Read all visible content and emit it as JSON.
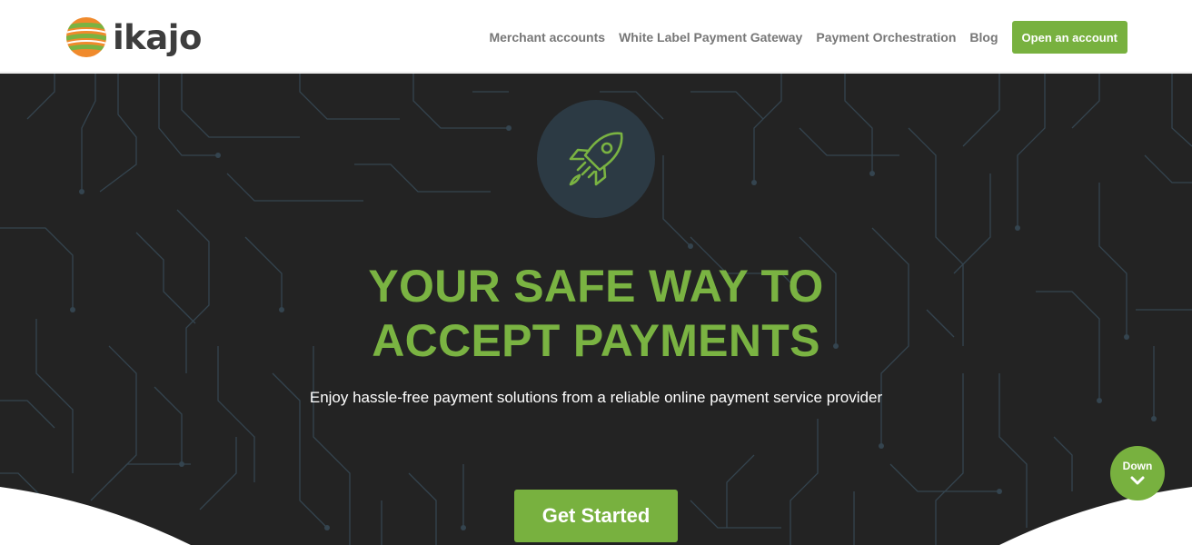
{
  "header": {
    "logo_text": "ikajo",
    "logo_icon": "striped-globe-logo-icon",
    "nav": [
      {
        "label": "Merchant accounts"
      },
      {
        "label": "White Label Payment Gateway"
      },
      {
        "label": "Payment Orchestration"
      },
      {
        "label": "Blog"
      }
    ],
    "cta_label": "Open an account"
  },
  "hero": {
    "icon": "rocket-icon",
    "title_line1": "YOUR SAFE WAY TO",
    "title_line2": "ACCEPT PAYMENTS",
    "subtitle": "Enjoy hassle-free payment solutions from a reliable online payment service provider",
    "cta_label": "Get Started",
    "down_label": "Down",
    "down_icon": "chevron-down-icon"
  },
  "colors": {
    "accent_green": "#78b13f",
    "hero_background": "#232323",
    "nav_text": "#777777",
    "logo_orange": "#f08a2c"
  }
}
